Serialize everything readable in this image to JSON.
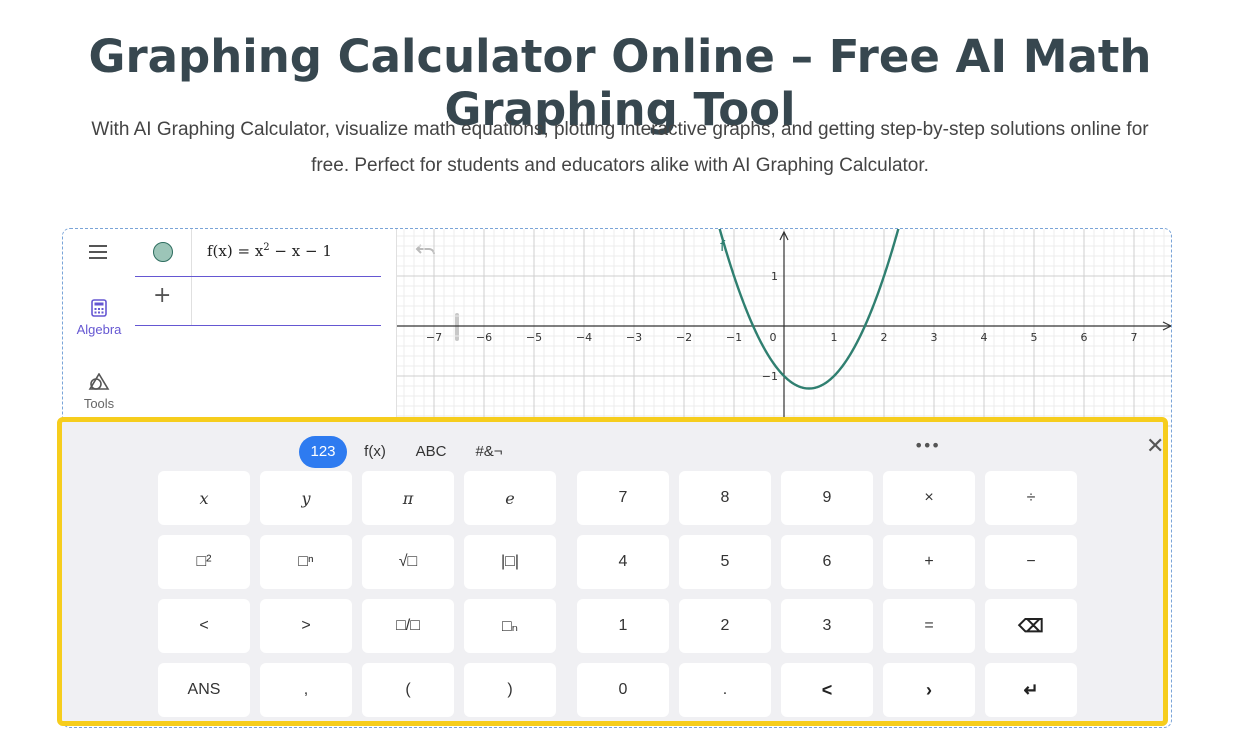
{
  "header": {
    "title": "Graphing Calculator Online – Free AI Math Graphing Tool",
    "subtitle_line1": "With AI Graphing Calculator, visualize math equations, plotting interactive graphs, and getting step-by-step solutions online for",
    "subtitle_line2": "free. Perfect for students and educators alike with AI Graphing Calculator."
  },
  "sidebar": {
    "items": [
      {
        "label": "Algebra",
        "icon": "calculator-icon",
        "active": true
      },
      {
        "label": "Tools",
        "icon": "shapes-icon",
        "active": false
      }
    ]
  },
  "algebra": {
    "expression": {
      "prefix": "f(x) = x",
      "exponent": "2",
      "suffix": " − x − 1"
    },
    "add_label": "+"
  },
  "graph": {
    "function_label": "f",
    "x_ticks": [
      "−7",
      "−6",
      "−5",
      "−4",
      "−3",
      "−2",
      "−1",
      "0",
      "1",
      "2",
      "3",
      "4",
      "5",
      "6",
      "7"
    ],
    "y_ticks": [
      "1",
      "−1"
    ],
    "curve_color": "#2f7f70"
  },
  "keyboard": {
    "tabs": [
      {
        "label": "123",
        "active": true
      },
      {
        "label": "f(x)",
        "active": false
      },
      {
        "label": "ABC",
        "active": false
      },
      {
        "label": "#&¬",
        "active": false
      }
    ],
    "more_label": "•••",
    "close_label": "✕",
    "rows": [
      [
        "x",
        "y",
        "π",
        "e",
        "7",
        "8",
        "9",
        "×",
        "÷"
      ],
      [
        "□²",
        "□ⁿ",
        "√□",
        "|□|",
        "4",
        "5",
        "6",
        "+",
        "−"
      ],
      [
        "<",
        ">",
        "□/□",
        "□ₙ",
        "1",
        "2",
        "3",
        "=",
        "⌫"
      ],
      [
        "ANS",
        ",",
        "(",
        ")",
        "0",
        ".",
        "<",
        "›",
        "↵"
      ]
    ]
  },
  "colors": {
    "accent": "#2e7bf0",
    "highlight_border": "#f6cd1d",
    "algebra_accent": "#6557d2"
  }
}
